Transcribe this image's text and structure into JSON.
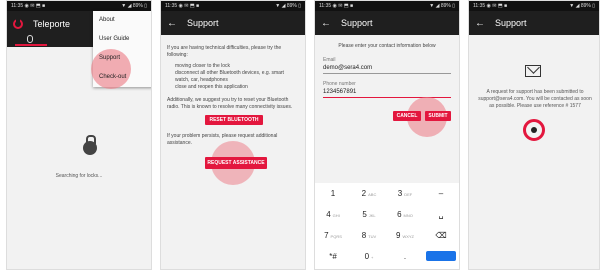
{
  "status_bar": {
    "left": "11:35 ◉ ✉ ⬒ ■",
    "right": "▼ ◢ 89% ▯"
  },
  "screen1": {
    "title": "Teleporte",
    "menu": [
      "About",
      "User Guide",
      "Support",
      "Check-out"
    ],
    "status": "Searching for locks..."
  },
  "screen2": {
    "title": "Support",
    "intro": "If you are having technical difficulties, please try the following:",
    "bullets": [
      "moving closer to the lock",
      "disconnect all other Bluetooth devices, e.g. smart watch, car, headphones",
      "close and reopen this application"
    ],
    "bt_text": "Additionally, we suggest you try to reset your Bluetooth radio. This is known to resolve many connectivity issues.",
    "reset_button": "RESET BLUETOOTH",
    "persist_text": "If your problem persists, please request additional assistance.",
    "request_button": "REQUEST ASSISTANCE"
  },
  "screen3": {
    "title": "Support",
    "prompt": "Please enter your contact information below",
    "email_label": "Email",
    "email_value": "demo@sera4.com",
    "phone_label": "Phone number",
    "phone_value": "1234567891",
    "cancel_button": "CANCEL",
    "submit_button": "SUBMIT",
    "keyboard": [
      [
        {
          "k": "1",
          "s": ""
        },
        {
          "k": "2",
          "s": "ABC"
        },
        {
          "k": "3",
          "s": "DEF"
        },
        {
          "k": "–",
          "s": ""
        }
      ],
      [
        {
          "k": "4",
          "s": "GHI"
        },
        {
          "k": "5",
          "s": "JKL"
        },
        {
          "k": "6",
          "s": "MNO"
        },
        {
          "k": "␣",
          "s": ""
        }
      ],
      [
        {
          "k": "7",
          "s": "PQRS"
        },
        {
          "k": "8",
          "s": "TUV"
        },
        {
          "k": "9",
          "s": "WXYZ"
        },
        {
          "k": "⌫",
          "s": ""
        }
      ],
      [
        {
          "k": "*#",
          "s": ""
        },
        {
          "k": "0",
          "s": "+"
        },
        {
          "k": ".",
          "s": ""
        },
        {
          "k": "✓",
          "s": ""
        }
      ]
    ]
  },
  "screen4": {
    "title": "Support",
    "message": "A request for support has been submitted to support@sera4.com. You will be contacted as soon as possible. Please use reference # 1577"
  },
  "colors": {
    "accent": "#e3173e",
    "toolbar": "#1f1f1f",
    "highlight": "#ec828c"
  }
}
